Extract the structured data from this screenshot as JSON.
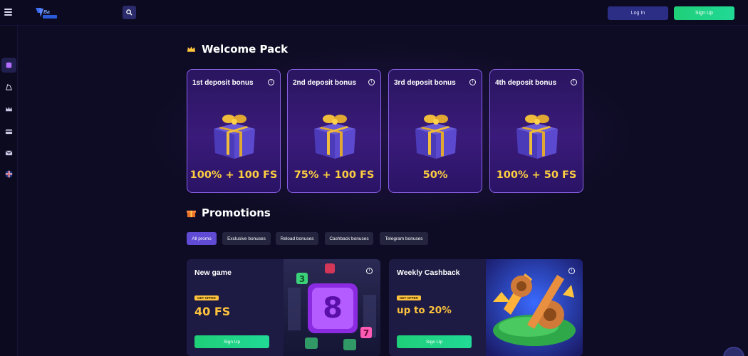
{
  "header": {
    "login_label": "Log In",
    "signup_label": "Sign Up"
  },
  "sidebar": {
    "items": [
      {
        "icon": "promo-puzzle-icon",
        "active": true
      },
      {
        "icon": "sports-icon"
      },
      {
        "icon": "crown-icon"
      },
      {
        "icon": "wallet-icon"
      },
      {
        "icon": "mail-icon"
      },
      {
        "icon": "uk-flag-icon"
      }
    ]
  },
  "welcome": {
    "title": "Welcome Pack",
    "cards": [
      {
        "title": "1st deposit bonus",
        "value": "100% + 100 FS"
      },
      {
        "title": "2nd deposit bonus",
        "value": "75% + 100 FS"
      },
      {
        "title": "3rd deposit bonus",
        "value": "50%"
      },
      {
        "title": "4th deposit bonus",
        "value": "100% + 50 FS"
      }
    ]
  },
  "promotions": {
    "title": "Promotions",
    "tabs": [
      "All promo",
      "Exclusive bonuses",
      "Reload bonuses",
      "Cashback bonuses",
      "Telegram bonuses"
    ],
    "cards": [
      {
        "title": "New game",
        "tag": "GET OFFER",
        "value": "40 FS",
        "button": "Sign Up"
      },
      {
        "title": "Weekly Cashback",
        "tag": "GET OFFER",
        "value": "up to 20%",
        "button": "Sign Up"
      }
    ]
  },
  "colors": {
    "accent_gold": "#ffcf40",
    "signup_green": "#21d996",
    "card_border": "#8a62e6",
    "active_tab": "#5f4bd4"
  }
}
